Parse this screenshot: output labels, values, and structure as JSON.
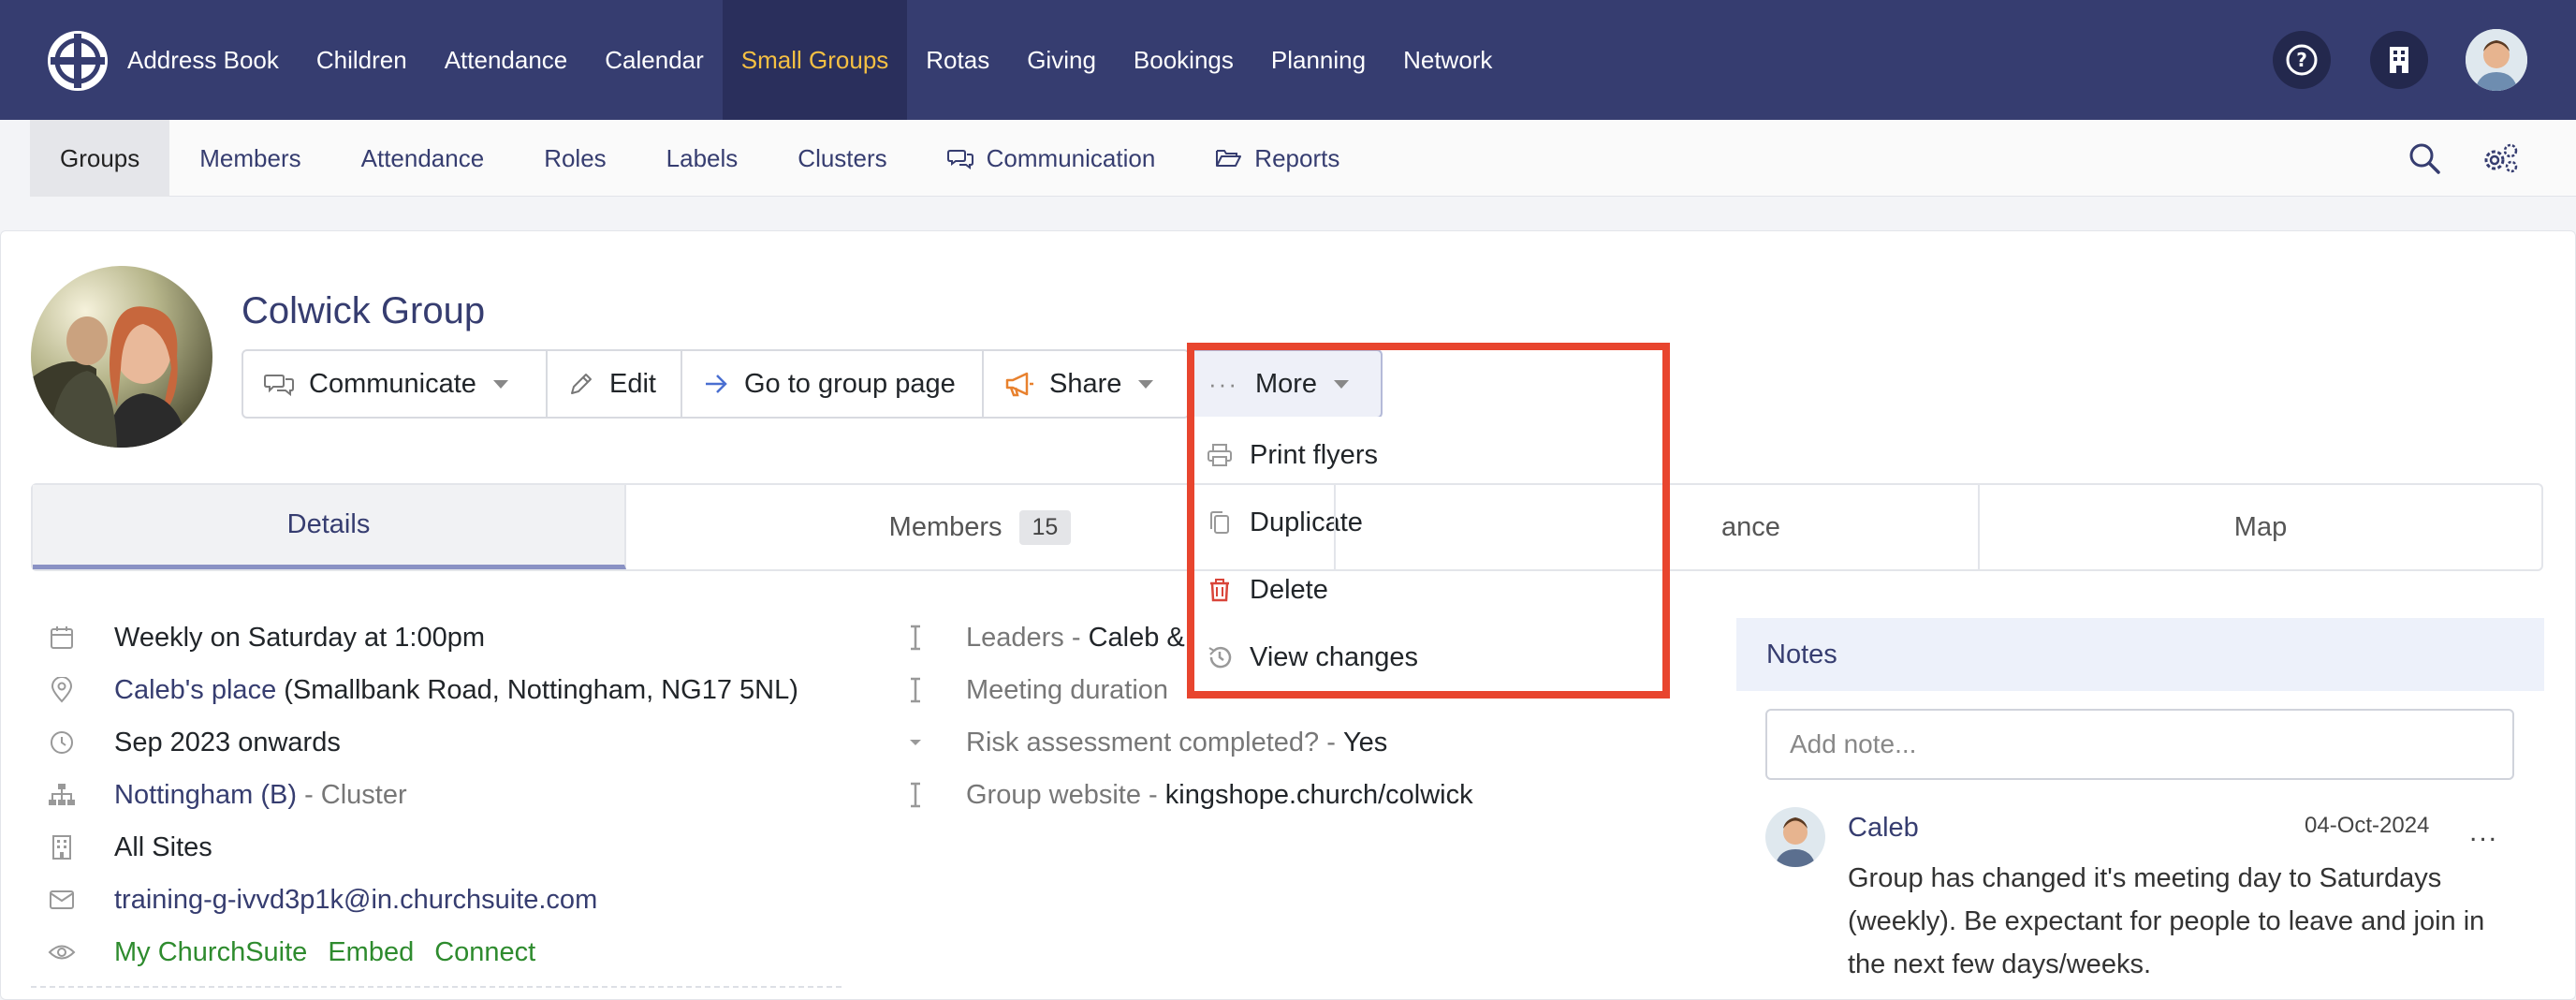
{
  "topnav": {
    "items": [
      {
        "label": "Address Book",
        "active": false
      },
      {
        "label": "Children",
        "active": false
      },
      {
        "label": "Attendance",
        "active": false
      },
      {
        "label": "Calendar",
        "active": false
      },
      {
        "label": "Small Groups",
        "active": true
      },
      {
        "label": "Rotas",
        "active": false
      },
      {
        "label": "Giving",
        "active": false
      },
      {
        "label": "Bookings",
        "active": false
      },
      {
        "label": "Planning",
        "active": false
      },
      {
        "label": "Network",
        "active": false
      }
    ],
    "icons": [
      "help-icon",
      "building-icon",
      "user-avatar"
    ]
  },
  "subnav": {
    "items": [
      {
        "label": "Groups",
        "active": true
      },
      {
        "label": "Members"
      },
      {
        "label": "Attendance"
      },
      {
        "label": "Roles"
      },
      {
        "label": "Labels"
      },
      {
        "label": "Clusters"
      },
      {
        "label": "Communication",
        "icon": "chat-icon"
      },
      {
        "label": "Reports",
        "icon": "folder-open-icon"
      }
    ]
  },
  "group": {
    "title": "Colwick Group"
  },
  "actions": {
    "communicate": "Communicate",
    "edit": "Edit",
    "go_to_group_page": "Go to group page",
    "share": "Share",
    "more": "More"
  },
  "more_menu": {
    "items": [
      {
        "label": "Print flyers",
        "icon": "printer-icon"
      },
      {
        "label": "Duplicate",
        "icon": "copy-icon"
      },
      {
        "label": "Delete",
        "icon": "trash-icon"
      },
      {
        "label": "View changes",
        "icon": "history-icon"
      }
    ]
  },
  "tabs": {
    "details": "Details",
    "members": "Members",
    "members_count": "15",
    "attendance_partial": "ance",
    "map": "Map"
  },
  "details": {
    "schedule": "Weekly on Saturday at 1:00pm",
    "location_link": "Caleb's place",
    "location_address": " (Smallbank Road, Nottingham, NG17 5NL)",
    "start": "Sep 2023 onwards",
    "cluster_link": "Nottingham (B)",
    "cluster_suffix": " - Cluster",
    "sites": "All Sites",
    "email": "training-g-ivvd3p1k@in.churchsuite.com",
    "visibility": [
      "My ChurchSuite",
      "Embed",
      "Connect"
    ]
  },
  "custom_fields": {
    "leaders_label": "Leaders - ",
    "leaders_value": "Caleb &",
    "meeting_label": "Meeting duration",
    "risk_label": "Risk assessment completed? - ",
    "risk_value": "Yes",
    "website_label": "Group website - ",
    "website_value": "kingshope.church/colwick"
  },
  "notes": {
    "heading": "Notes",
    "placeholder": "Add note...",
    "entry": {
      "author": "Caleb",
      "date": "04-Oct-2024",
      "menu": "...",
      "text": "Group has changed it's meeting day to Saturdays (weekly). Be expectant for people to leave and join in the next few days/weeks."
    }
  },
  "colors": {
    "nav_bg": "#363d70",
    "active_nav": "#f5c043",
    "highlight": "#e8452e",
    "green_link": "#2e8b2e"
  }
}
